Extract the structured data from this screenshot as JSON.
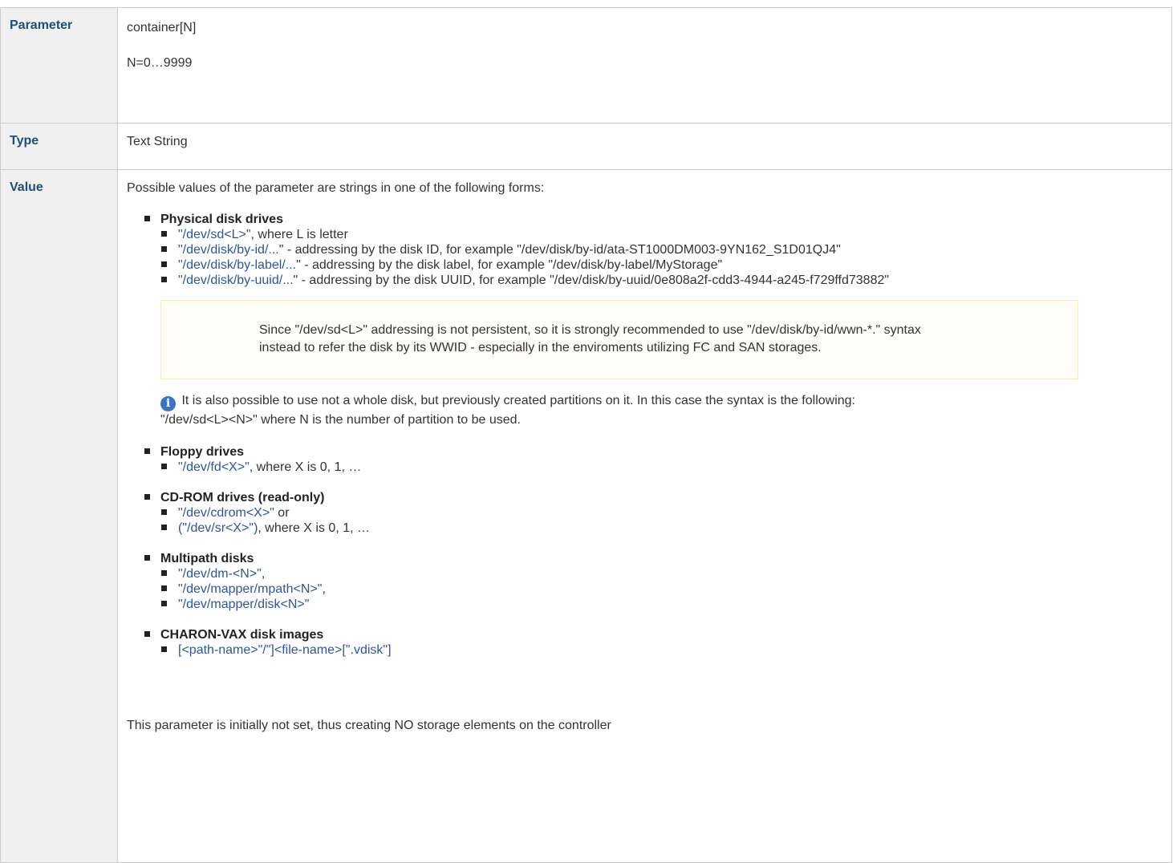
{
  "rows": {
    "parameter": {
      "label": "Parameter",
      "value_line1": "container[N]",
      "value_line2": "N=0…9999"
    },
    "type": {
      "label": "Type",
      "value": "Text String"
    },
    "value": {
      "label": "Value",
      "intro": "Possible values of the parameter are strings in one of the following forms:",
      "physical": {
        "title": "Physical disk drives",
        "items": [
          {
            "link": "\"/dev/sd<L>\"",
            "rest": ", where L is letter"
          },
          {
            "link": "\"/dev/disk/by-id/...",
            "rest": "\" - addressing by the disk ID, for example \"/dev/disk/by-id/ata-ST1000DM003-9YN162_S1D01QJ4\""
          },
          {
            "link": "\"/dev/disk/by-label/...",
            "rest": "\" - addressing by the disk label, for example \"/dev/disk/by-label/MyStorage\""
          },
          {
            "link": "\"/dev/disk/by-uuid/...",
            "rest": "\" - addressing by the disk UUID, for example \"/dev/disk/by-uuid/0e808a2f-cdd3-4944-a245-f729ffd73882\""
          }
        ],
        "warning_line1": "Since \"/dev/sd<L>\" addressing is not persistent, so it is strongly recommended to use \"/dev/disk/by-id/wwn-*.\" syntax",
        "warning_line2": "instead to refer the disk by its WWID - especially in the enviroments utilizing FC and SAN storages.",
        "info_line1": " It is also possible to use not a whole disk, but previously created partitions on it. In this case the syntax is the following:",
        "info_line2": "\"/dev/sd<L><N>\" where N is the number of partition to be used."
      },
      "floppy": {
        "title": "Floppy drives",
        "items": [
          {
            "link": "\"/dev/fd<X>\"",
            "rest": ", where X is 0, 1, …"
          }
        ]
      },
      "cdrom": {
        "title": "CD-ROM drives (read-only)",
        "items": [
          {
            "link": "\"/dev/cdrom<X>\"",
            "rest": " or"
          },
          {
            "link": "(\"/dev/sr<X>\")",
            "rest": ", where X is 0, 1, …"
          }
        ]
      },
      "multipath": {
        "title": "Multipath disks",
        "items": [
          {
            "link": "\"/dev/dm-<N>\"",
            "rest": ","
          },
          {
            "link": "\"/dev/mapper/mpath<N>\"",
            "rest": ","
          },
          {
            "link": "\"/dev/mapper/disk<N>\"",
            "rest": ""
          }
        ]
      },
      "charon": {
        "title": "CHARON-VAX disk images",
        "items": [
          {
            "link": "[<path-name>\"/\"]<file-name>[\".vdisk\"]",
            "rest": ""
          }
        ]
      },
      "footer": "This parameter is initially not set, thus creating NO storage elements on the controller"
    }
  },
  "colors": {
    "header_bg": "#f0f0f0",
    "header_text": "#1f4e79",
    "link": "#2c55a1",
    "border": "#cccccc",
    "warning_bg": "#fffdf6",
    "warning_border": "#ffeaae",
    "info_icon": "#3b73c4"
  },
  "icons": {
    "info": "information-icon",
    "bullet": "square-bullet"
  }
}
